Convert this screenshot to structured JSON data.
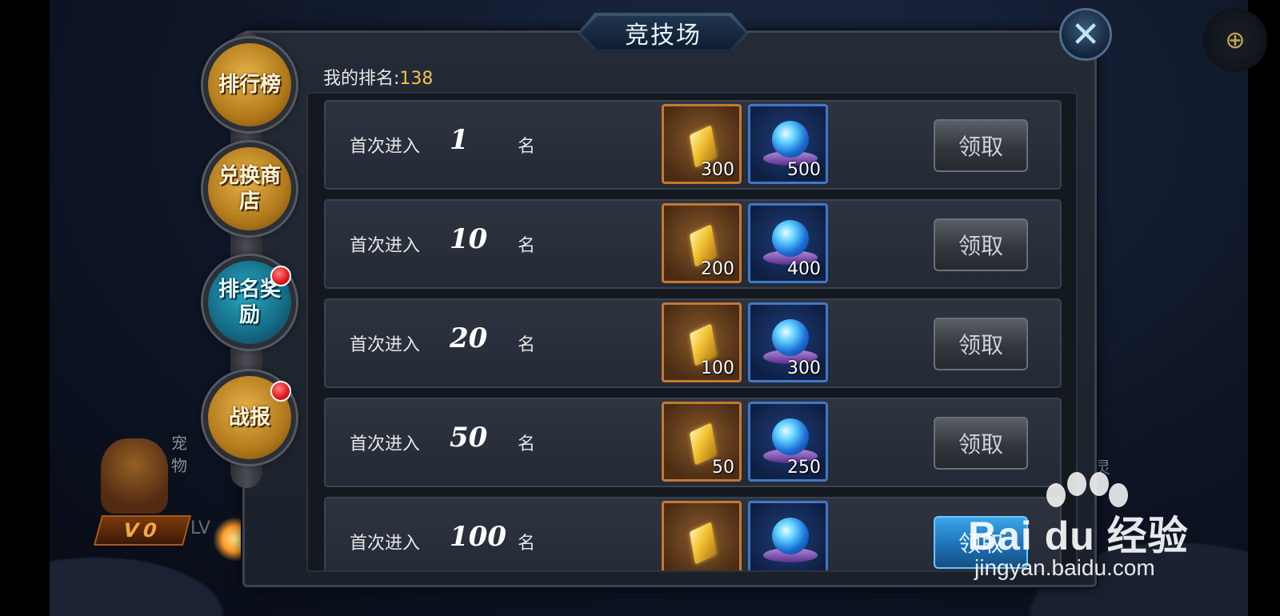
{
  "title": "竞技场",
  "my_rank": {
    "label": "我的排名:",
    "value": "138"
  },
  "tabs": [
    {
      "label": "排行榜",
      "badge": false,
      "style": "gold"
    },
    {
      "label": "兑换商店",
      "badge": false,
      "style": "gold"
    },
    {
      "label": "排名奖励",
      "badge": true,
      "style": "teal",
      "selected": true
    },
    {
      "label": "战报",
      "badge": true,
      "style": "gold"
    }
  ],
  "rewards": [
    {
      "prefix": "首次进入",
      "rank": "1",
      "suffix": "名",
      "gold": "300",
      "gem": "500",
      "button": "领取",
      "button_active": false
    },
    {
      "prefix": "首次进入",
      "rank": "10",
      "suffix": "名",
      "gold": "200",
      "gem": "400",
      "button": "领取",
      "button_active": false
    },
    {
      "prefix": "首次进入",
      "rank": "20",
      "suffix": "名",
      "gold": "100",
      "gem": "300",
      "button": "领取",
      "button_active": false
    },
    {
      "prefix": "首次进入",
      "rank": "50",
      "suffix": "名",
      "gold": "50",
      "gem": "250",
      "button": "领取",
      "button_active": false
    },
    {
      "prefix": "首次进入",
      "rank": "100",
      "suffix": "名",
      "gold": "",
      "gem": "",
      "button": "领取",
      "button_active": true
    }
  ],
  "background": {
    "pet_label": "宠物",
    "vip": "V0",
    "lv": "LV",
    "right_label": "灵"
  },
  "watermark": {
    "brand": "Bai du 经验",
    "url": "jingyan.baidu.com"
  },
  "colors": {
    "rank_value": "#f2c14e",
    "gold_border": "#c8782e",
    "gem_border": "#3f78c8",
    "badge": "#e0161b"
  },
  "icons": {
    "close": "close-icon",
    "gold": "gold-bar-icon",
    "gem": "gem-orb-icon"
  }
}
